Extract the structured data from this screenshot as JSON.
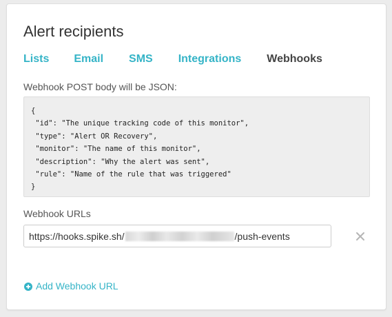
{
  "page": {
    "title": "Alert recipients"
  },
  "tabs": [
    {
      "label": "Lists",
      "active": false
    },
    {
      "label": "Email",
      "active": false
    },
    {
      "label": "SMS",
      "active": false
    },
    {
      "label": "Integrations",
      "active": false
    },
    {
      "label": "Webhooks",
      "active": true
    }
  ],
  "webhook": {
    "json_label": "Webhook POST body will be JSON:",
    "json_lines": [
      "{",
      " \"id\": \"The unique tracking code of this monitor\",",
      " \"type\": \"Alert OR Recovery\",",
      " \"monitor\": \"The name of this monitor\",",
      " \"description\": \"Why the alert was sent\",",
      " \"rule\": \"Name of the rule that was triggered\"",
      "}"
    ],
    "urls_label": "Webhook URLs",
    "url_prefix": "https://hooks.spike.sh/",
    "url_suffix": "/push-events",
    "remove_icon": "close-icon",
    "add_label": "Add Webhook URL",
    "add_icon": "plus-circle-icon"
  },
  "colors": {
    "accent": "#35b4c7",
    "active_tab": "#444444",
    "code_background": "#eeeeee",
    "background": "#ececec"
  }
}
